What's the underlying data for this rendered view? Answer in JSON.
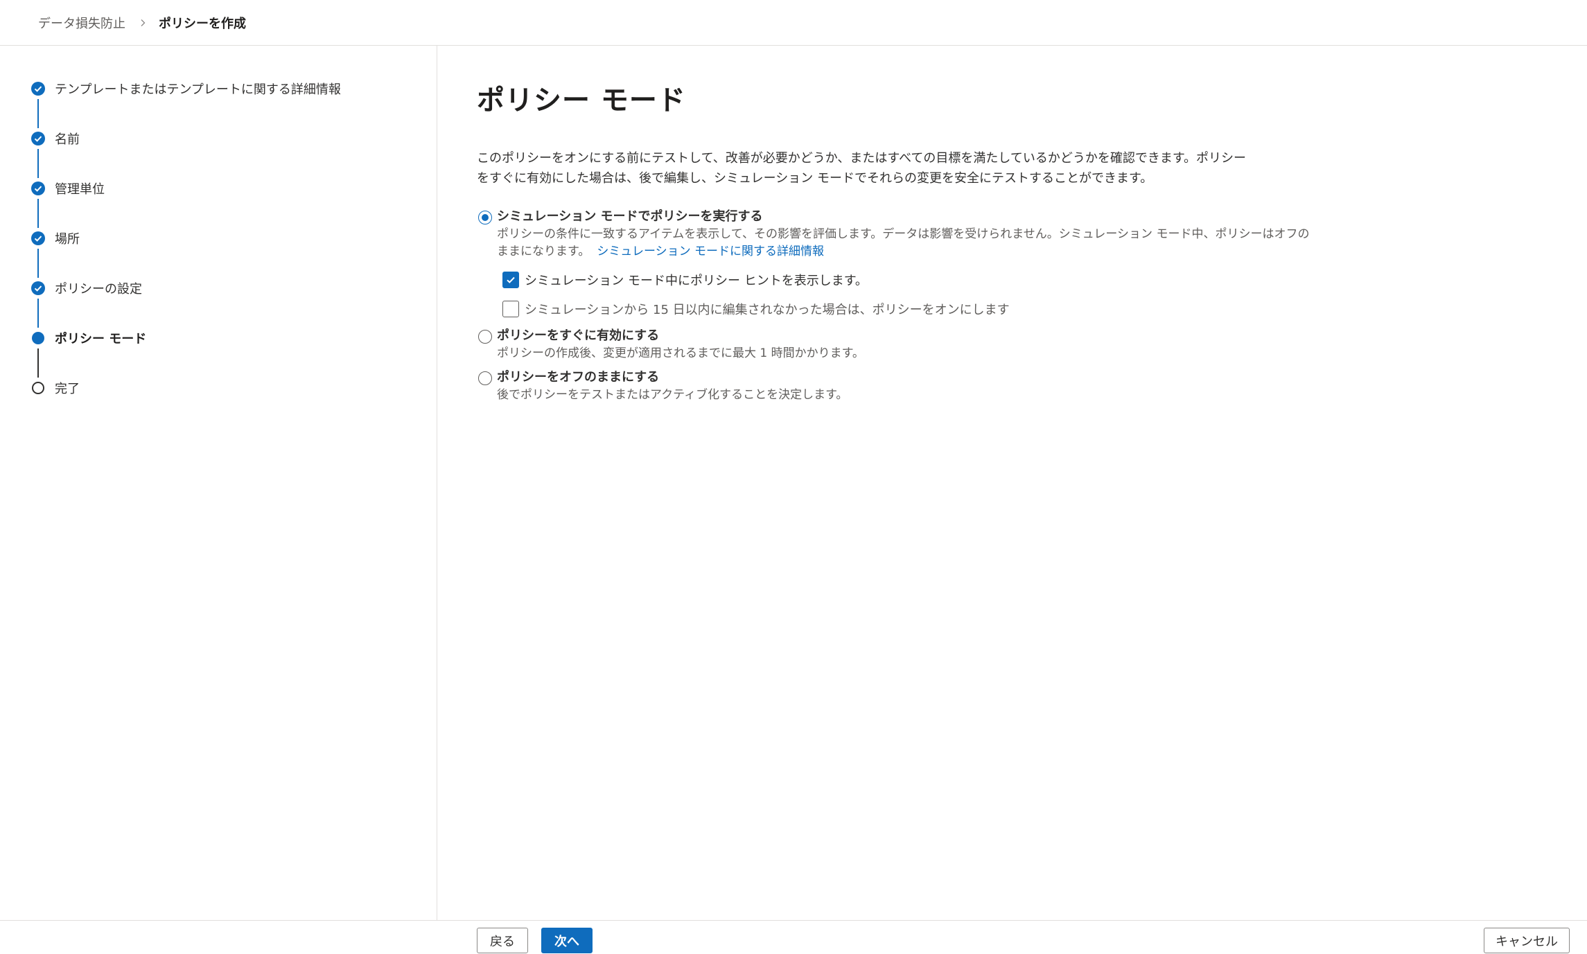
{
  "breadcrumb": {
    "parent": "データ損失防止",
    "current": "ポリシーを作成"
  },
  "steps": [
    {
      "label": "テンプレートまたはテンプレートに関する詳細情報",
      "state": "completed"
    },
    {
      "label": "名前",
      "state": "completed"
    },
    {
      "label": "管理単位",
      "state": "completed"
    },
    {
      "label": "場所",
      "state": "completed"
    },
    {
      "label": "ポリシーの設定",
      "state": "completed"
    },
    {
      "label": "ポリシー モード",
      "state": "current"
    },
    {
      "label": "完了",
      "state": "pending"
    }
  ],
  "main": {
    "title": "ポリシー モード",
    "intro_line1": "このポリシーをオンにする前にテストして、改善が必要かどうか、またはすべての目標を満たしているかどうかを確認できます。ポリシー",
    "intro_line2": "をすぐに有効にした場合は、後で編集し、シミュレーション モードでそれらの変更を安全にテストすることができます。",
    "options": [
      {
        "title": "シミュレーション モードでポリシーを実行する",
        "desc_line1": "ポリシーの条件に一致するアイテムを表示して、その影響を評価します。データは影響を受けられません。シミュレーション モード中、ポリシーはオフの",
        "desc_line2": "ままになります。",
        "link": "シミュレーション モードに関する詳細情報",
        "selected": true
      },
      {
        "title": "ポリシーをすぐに有効にする",
        "desc": "ポリシーの作成後、変更が適用されるまでに最大 1 時間かかります。",
        "selected": false
      },
      {
        "title": "ポリシーをオフのままにする",
        "desc": "後でポリシーをテストまたはアクティブ化することを決定します。",
        "selected": false
      }
    ],
    "checkboxes": [
      {
        "label": "シミュレーション モード中にポリシー ヒントを表示します。",
        "checked": true
      },
      {
        "label": "シミュレーションから 15 日以内に編集されなかった場合は、ポリシーをオンにします",
        "checked": false
      }
    ]
  },
  "footer": {
    "back_label": "戻る",
    "next_label": "次へ",
    "cancel_label": "キャンセル"
  },
  "colors": {
    "accent": "#0f6cbd",
    "border": "#e1dfdd",
    "text": "#323130",
    "muted": "#605e5c"
  }
}
